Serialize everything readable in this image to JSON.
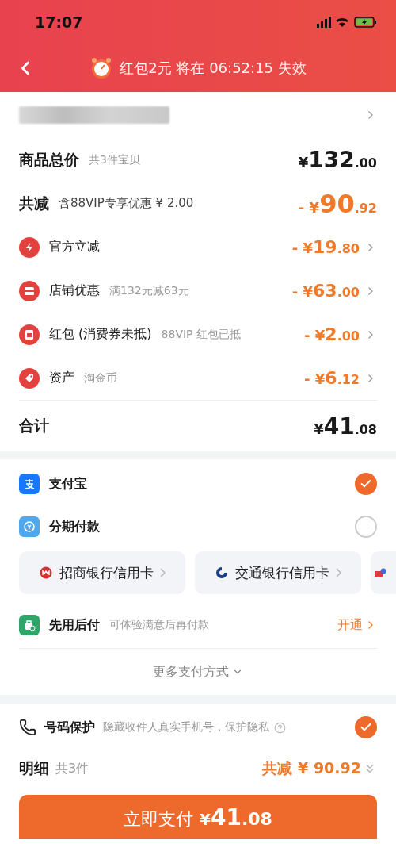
{
  "status_bar": {
    "time": "17:07"
  },
  "nav": {
    "timer_text": "红包2元 将在 06:52:15 失效"
  },
  "summary": [
    {
      "kind": "total",
      "label": "商品总价",
      "note": "共3件宝贝",
      "currency": "¥",
      "main": "132",
      "cents": ".00"
    },
    {
      "kind": "saving",
      "label": "共减",
      "note": "含88VIP专享优惠 ¥ 2.00",
      "sign": "-",
      "currency": "¥",
      "main": "90",
      "cents": ".92"
    },
    {
      "kind": "discount",
      "label": "官方立减",
      "sign": "-",
      "currency": "¥",
      "main": "19",
      "cents": ".80"
    },
    {
      "kind": "discount",
      "label": "店铺优惠",
      "note": "满132元减63元",
      "sign": "-",
      "currency": "¥",
      "main": "63",
      "cents": ".00"
    },
    {
      "kind": "discount",
      "label": "红包 (消费券未抵)",
      "note": "88VIP 红包已抵",
      "sign": "-",
      "currency": "¥",
      "main": "2",
      "cents": ".00"
    },
    {
      "kind": "discount",
      "label": "资产",
      "note": "淘金币",
      "sign": "-",
      "currency": "¥",
      "main": "6",
      "cents": ".12"
    },
    {
      "kind": "sum",
      "label": "合计",
      "currency": "¥",
      "main": "41",
      "cents": ".08"
    }
  ],
  "payment": {
    "methods": [
      {
        "label": "支付宝",
        "selected": true
      },
      {
        "label": "分期付款",
        "selected": false
      }
    ],
    "banks": [
      {
        "name": "招商银行信用卡"
      },
      {
        "name": "交通银行信用卡"
      }
    ],
    "pay_later": {
      "label": "先用后付",
      "note": "可体验满意后再付款",
      "action": "开通"
    },
    "more": "更多支付方式"
  },
  "protection": {
    "label": "号码保护",
    "note": "隐藏收件人真实手机号，保护隐私",
    "checked": true
  },
  "details": {
    "label": "明细",
    "count": "共3件",
    "saving": "共减 ¥ 90.92"
  },
  "pay_button": {
    "label": "立即支付",
    "currency": "¥",
    "main": "41",
    "cents": ".08"
  }
}
